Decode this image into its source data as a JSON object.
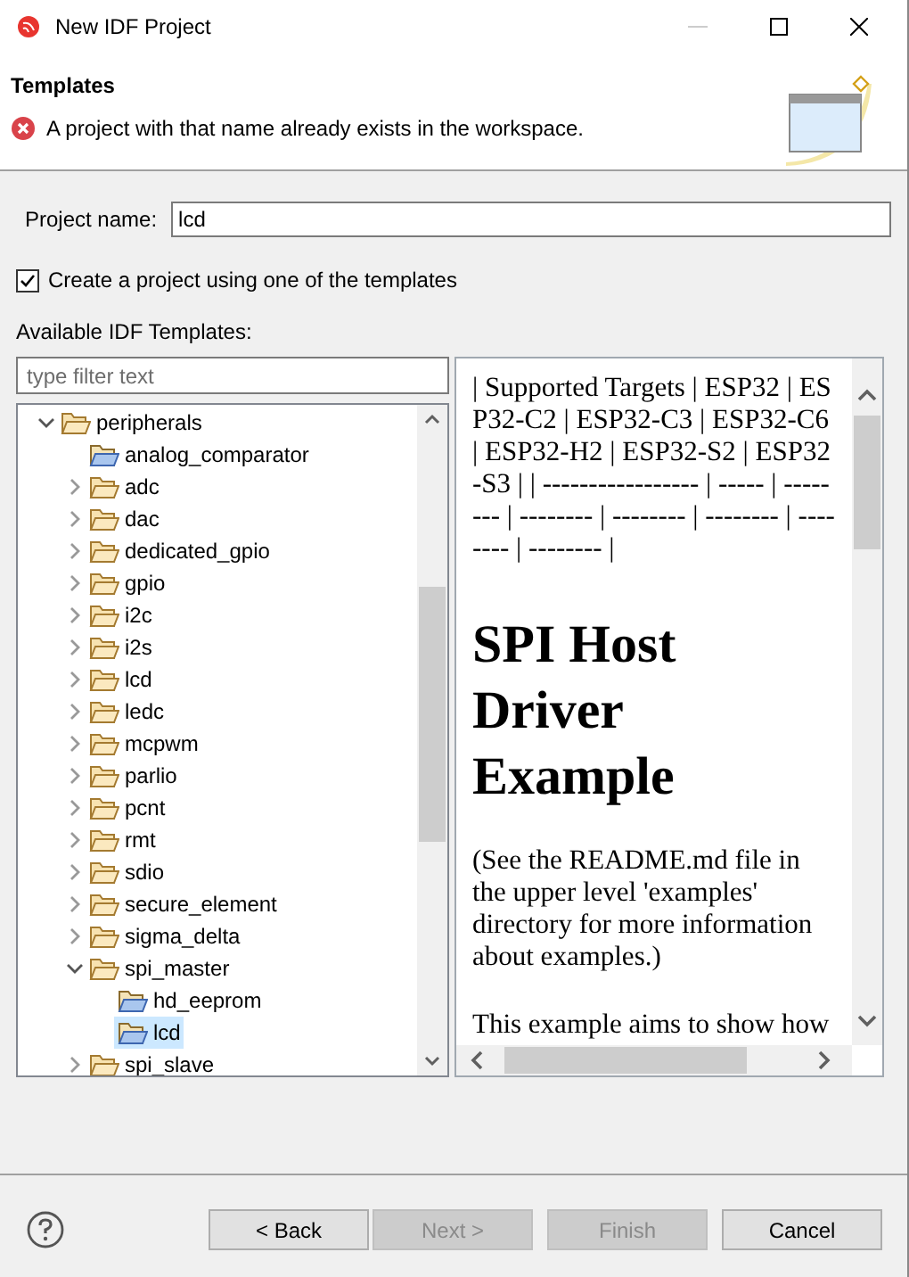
{
  "window": {
    "title": "New IDF Project"
  },
  "header": {
    "title": "Templates",
    "message": "A project with that name already exists in the workspace."
  },
  "project_name": {
    "label": "Project name:",
    "value": "lcd"
  },
  "use_template": {
    "label": "Create a project using one of the templates",
    "checked": true
  },
  "templates_label": "Available IDF Templates:",
  "filter": {
    "placeholder": "type filter text"
  },
  "tree": [
    {
      "label": "peripherals",
      "kind": "folder",
      "expanded": true,
      "selected": false,
      "children": [
        {
          "label": "analog_comparator",
          "kind": "project",
          "selected": false
        },
        {
          "label": "adc",
          "kind": "folder",
          "expanded": false,
          "selected": false
        },
        {
          "label": "dac",
          "kind": "folder",
          "expanded": false,
          "selected": false
        },
        {
          "label": "dedicated_gpio",
          "kind": "folder",
          "expanded": false,
          "selected": false
        },
        {
          "label": "gpio",
          "kind": "folder",
          "expanded": false,
          "selected": false
        },
        {
          "label": "i2c",
          "kind": "folder",
          "expanded": false,
          "selected": false
        },
        {
          "label": "i2s",
          "kind": "folder",
          "expanded": false,
          "selected": false
        },
        {
          "label": "lcd",
          "kind": "folder",
          "expanded": false,
          "selected": false
        },
        {
          "label": "ledc",
          "kind": "folder",
          "expanded": false,
          "selected": false
        },
        {
          "label": "mcpwm",
          "kind": "folder",
          "expanded": false,
          "selected": false
        },
        {
          "label": "parlio",
          "kind": "folder",
          "expanded": false,
          "selected": false
        },
        {
          "label": "pcnt",
          "kind": "folder",
          "expanded": false,
          "selected": false
        },
        {
          "label": "rmt",
          "kind": "folder",
          "expanded": false,
          "selected": false
        },
        {
          "label": "sdio",
          "kind": "folder",
          "expanded": false,
          "selected": false
        },
        {
          "label": "secure_element",
          "kind": "folder",
          "expanded": false,
          "selected": false
        },
        {
          "label": "sigma_delta",
          "kind": "folder",
          "expanded": false,
          "selected": false
        },
        {
          "label": "spi_master",
          "kind": "folder",
          "expanded": true,
          "selected": false,
          "children": [
            {
              "label": "hd_eeprom",
              "kind": "project",
              "selected": false
            },
            {
              "label": "lcd",
              "kind": "project",
              "selected": true
            }
          ]
        },
        {
          "label": "spi_slave",
          "kind": "folder",
          "expanded": false,
          "selected": false
        }
      ]
    }
  ],
  "preview": {
    "targets": "| Supported Targets | ESP32 | ESP32-C2 | ESP32-C3 | ESP32-C6 | ESP32-H2 | ESP32-S2 | ESP32-S3 | | ----------------- | ----- | -------- | -------- | -------- | -------- | -------- | -------- |",
    "heading": "SPI Host Driver Example",
    "paragraphs": [
      "(See the README.md file in the upper level 'examples' directory for more information about examples.)",
      "This example aims to show how"
    ]
  },
  "buttons": [
    {
      "label": "< Back",
      "disabled": false
    },
    {
      "label": "Next >",
      "disabled": true
    },
    {
      "label": "Finish",
      "disabled": true
    },
    {
      "label": "Cancel",
      "disabled": false
    }
  ]
}
